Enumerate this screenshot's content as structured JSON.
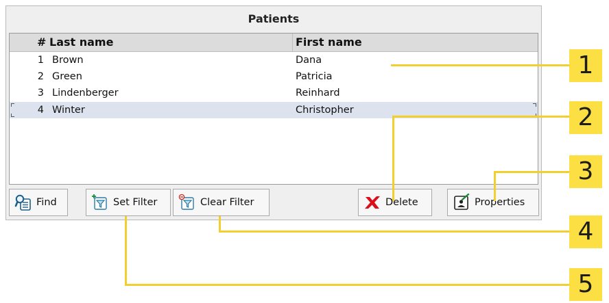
{
  "panel": {
    "title": "Patients"
  },
  "columns": {
    "num": "#",
    "last": "Last name",
    "first": "First name"
  },
  "rows": [
    {
      "num": "1",
      "last": "Brown",
      "first": "Dana"
    },
    {
      "num": "2",
      "last": "Green",
      "first": "Patricia"
    },
    {
      "num": "3",
      "last": "Lindenberger",
      "first": "Reinhard"
    },
    {
      "num": "4",
      "last": "Winter",
      "first": "Christopher",
      "selected": true
    }
  ],
  "toolbar": {
    "find": "Find",
    "set_filter": "Set Filter",
    "clear_filter": "Clear Filter",
    "delete": "Delete",
    "properties": "Properties"
  },
  "callouts": {
    "c1": "1",
    "c2": "2",
    "c3": "3",
    "c4": "4",
    "c5": "5"
  },
  "colors": {
    "callout": "#fce043",
    "delete_icon": "#d9101c",
    "selection": "#dde3ee"
  },
  "icons": [
    "find-icon",
    "set-filter-icon",
    "clear-filter-icon",
    "delete-icon",
    "properties-icon"
  ]
}
